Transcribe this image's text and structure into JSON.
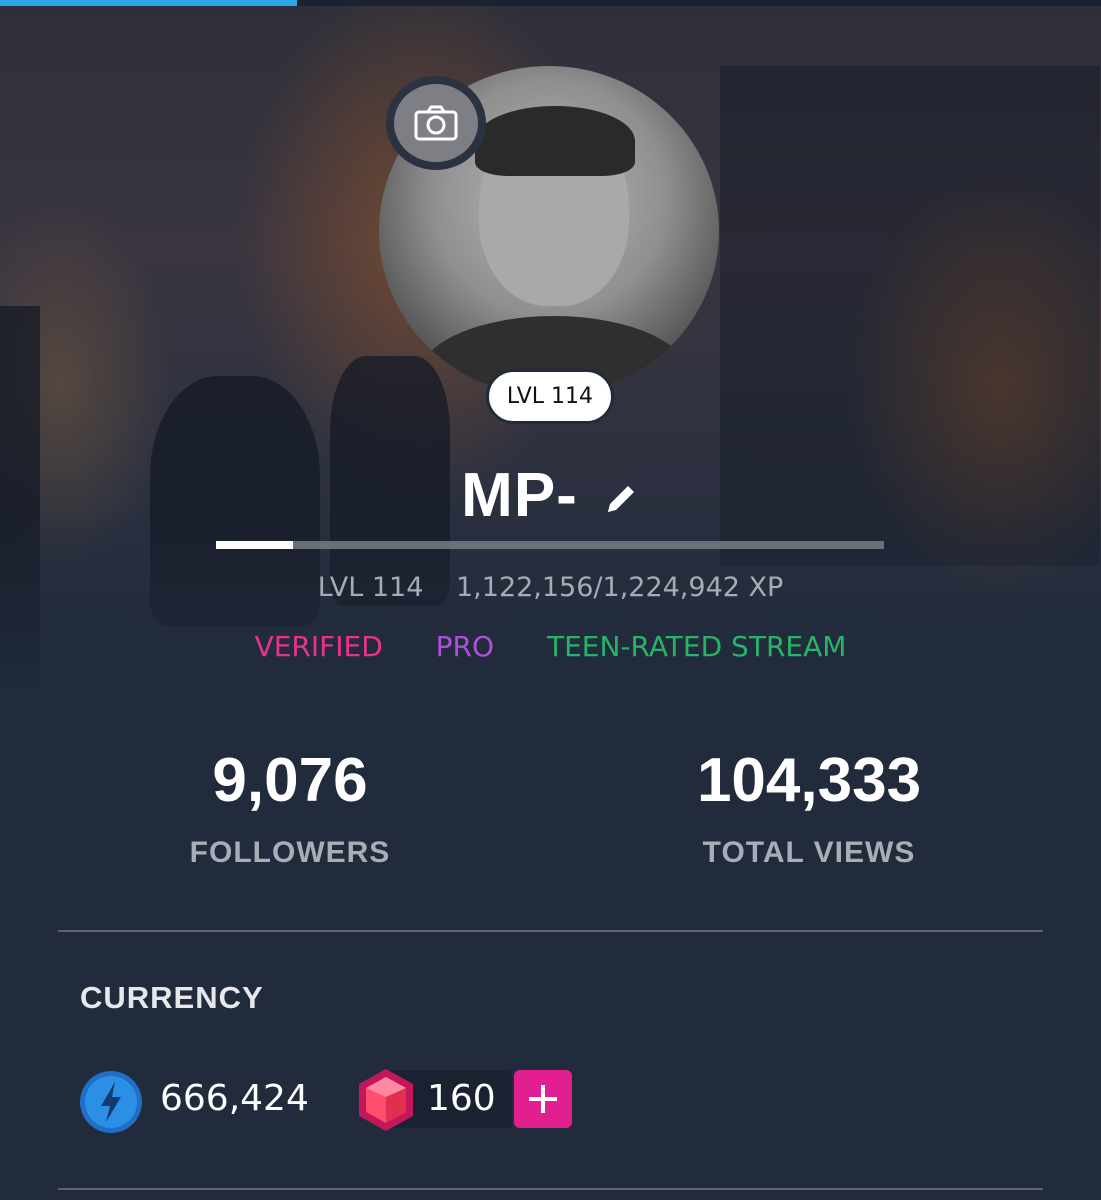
{
  "progress": {
    "top_loading_fraction": 0.27,
    "xp_fraction": 0.115
  },
  "profile": {
    "level_badge": "LVL 114",
    "username": "MP-",
    "level_text": "LVL 114",
    "xp_text": "1,122,156/1,224,942 XP"
  },
  "badges": [
    {
      "label": "VERIFIED",
      "color": "#e8328c"
    },
    {
      "label": "PRO",
      "color": "#b04ee0"
    },
    {
      "label": "TEEN-RATED STREAM",
      "color": "#27b46a"
    }
  ],
  "stats": {
    "followers": {
      "value": "9,076",
      "label": "FOLLOWERS"
    },
    "total_views": {
      "value": "104,333",
      "label": "TOTAL VIEWS"
    }
  },
  "currency": {
    "title": "CURRENCY",
    "sparks": {
      "value": "666,424",
      "icon": "lightning-coin-icon",
      "color": "#2c8fe6"
    },
    "gems": {
      "value": "160",
      "icon": "gem-icon",
      "color": "#ff3e6c",
      "add_icon": "plus-icon",
      "add_color": "#e21f8e"
    }
  },
  "icons": {
    "camera": "camera-icon",
    "edit": "pencil-icon"
  }
}
